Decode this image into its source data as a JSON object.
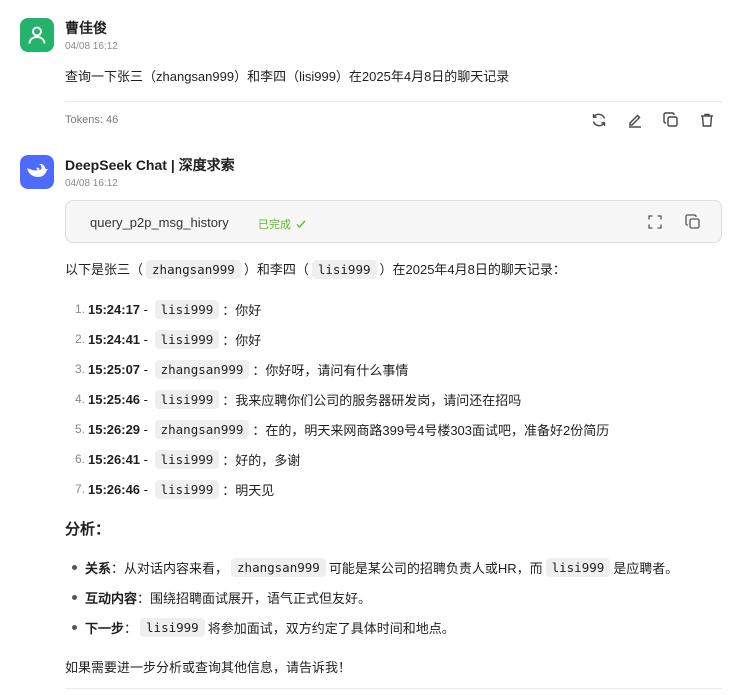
{
  "user_msg": {
    "name": "曹佳俊",
    "time": "04/08 16:12",
    "text": "查询一下张三（zhangsan999）和李四（lisi999）在2025年4月8日的聊天记录",
    "tokens": "Tokens: 46"
  },
  "bot_msg": {
    "name": "DeepSeek Chat | 深度求索",
    "time": "04/08 16:12",
    "tool": {
      "name": "query_p2p_msg_history",
      "status": "已完成"
    },
    "intro": {
      "a": "以下是张三（",
      "code1": "zhangsan999",
      "b": "）和李四（",
      "code2": "lisi999",
      "c": "）在2025年4月8日的聊天记录："
    },
    "messages": [
      {
        "num": "1.",
        "time": "15:24:17",
        "sep": " - ",
        "user": "lisi999",
        "text": "：你好"
      },
      {
        "num": "2.",
        "time": "15:24:41",
        "sep": " - ",
        "user": "lisi999",
        "text": "：你好"
      },
      {
        "num": "3.",
        "time": "15:25:07",
        "sep": " - ",
        "user": "zhangsan999",
        "text": "：你好呀，请问有什么事情"
      },
      {
        "num": "4.",
        "time": "15:25:46",
        "sep": " - ",
        "user": "lisi999",
        "text": "：我来应聘你们公司的服务器研发岗，请问还在招吗"
      },
      {
        "num": "5.",
        "time": "15:26:29",
        "sep": " - ",
        "user": "zhangsan999",
        "text": "：在的，明天来网商路399号4号楼303面试吧，准备好2份简历"
      },
      {
        "num": "6.",
        "time": "15:26:41",
        "sep": " - ",
        "user": "lisi999",
        "text": "：好的，多谢"
      },
      {
        "num": "7.",
        "time": "15:26:46",
        "sep": " - ",
        "user": "lisi999",
        "text": "：明天见"
      }
    ],
    "analysis_title": "分析：",
    "analysis": {
      "relation": {
        "label": "关系",
        "a": "：从对话内容来看，",
        "code1": "zhangsan999",
        "b": "可能是某公司的招聘负责人或HR，而",
        "code2": "lisi999",
        "c": "是应聘者。"
      },
      "interaction": {
        "label": "互动内容",
        "text": "：围绕招聘面试展开，语气正式但友好。"
      },
      "next": {
        "label": "下一步",
        "a": "：",
        "code": "lisi999",
        "b": "将参加面试，双方约定了具体时间和地点。"
      }
    },
    "closing": "如果需要进一步分析或查询其他信息，请告诉我！"
  },
  "icons": [
    "user-avatar-icon",
    "deepseek-whale-icon",
    "refresh-icon",
    "edit-icon",
    "copy-icon",
    "delete-icon",
    "check-icon",
    "expand-icon"
  ],
  "colors": {
    "user_avatar": "#24b36b",
    "bot_avatar": "#4d6bfe",
    "status_green": "#52c41a"
  }
}
